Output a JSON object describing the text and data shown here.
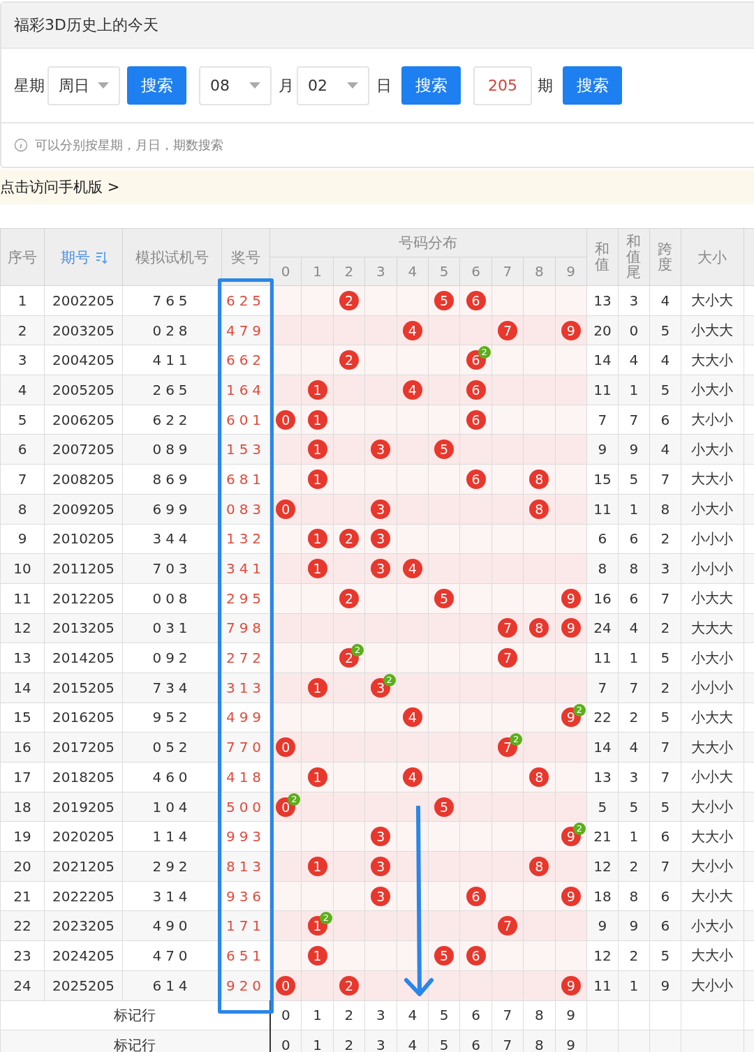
{
  "title": "福彩3D历史上的今天",
  "controls": [
    {
      "kind": "label",
      "text": "星期"
    },
    {
      "kind": "select",
      "value": "周日"
    },
    {
      "kind": "button",
      "text": "搜索"
    },
    {
      "kind": "select",
      "value": "08"
    },
    {
      "kind": "label",
      "text": "月"
    },
    {
      "kind": "select",
      "value": "02"
    },
    {
      "kind": "label",
      "text": "日"
    },
    {
      "kind": "button",
      "text": "搜索"
    },
    {
      "kind": "input",
      "value": "205"
    },
    {
      "kind": "label",
      "text": "期"
    },
    {
      "kind": "button",
      "text": "搜索"
    }
  ],
  "hint": "可以分别按星期，月日，期数搜索",
  "mobile_link": "点击访问手机版 >",
  "table": {
    "columns_left": [
      {
        "label": "序号",
        "sorted": false
      },
      {
        "label": "期号",
        "sorted": true
      },
      {
        "label": "模拟试机号",
        "sorted": false
      },
      {
        "label": "奖号",
        "sorted": false
      }
    ],
    "distribution_title": "号码分布",
    "digits": [
      "0",
      "1",
      "2",
      "3",
      "4",
      "5",
      "6",
      "7",
      "8",
      "9"
    ],
    "columns_right": [
      {
        "label": "和值",
        "sorted": false
      },
      {
        "label": "和值尾",
        "sorted": false
      },
      {
        "label": "跨度",
        "sorted": false
      },
      {
        "label": "大小",
        "sorted": false
      }
    ],
    "rows": [
      {
        "no": "1",
        "issue": "2002205",
        "trial": "765",
        "prize": "625",
        "distribution": [
          {
            "ball": false
          },
          {
            "ball": false
          },
          {
            "ball": true,
            "digit": "2"
          },
          {
            "ball": false
          },
          {
            "ball": false
          },
          {
            "ball": true,
            "digit": "5"
          },
          {
            "ball": true,
            "digit": "6"
          },
          {
            "ball": false
          },
          {
            "ball": false
          },
          {
            "ball": false
          }
        ],
        "sum": "13",
        "tail": "3",
        "span": "4",
        "size": "大小大"
      },
      {
        "no": "2",
        "issue": "2003205",
        "trial": "028",
        "prize": "479",
        "distribution": [
          {
            "ball": false
          },
          {
            "ball": false
          },
          {
            "ball": false
          },
          {
            "ball": false
          },
          {
            "ball": true,
            "digit": "4"
          },
          {
            "ball": false
          },
          {
            "ball": false
          },
          {
            "ball": true,
            "digit": "7"
          },
          {
            "ball": false
          },
          {
            "ball": true,
            "digit": "9"
          }
        ],
        "sum": "20",
        "tail": "0",
        "span": "5",
        "size": "小大大"
      },
      {
        "no": "3",
        "issue": "2004205",
        "trial": "411",
        "prize": "662",
        "distribution": [
          {
            "ball": false
          },
          {
            "ball": false
          },
          {
            "ball": true,
            "digit": "2"
          },
          {
            "ball": false
          },
          {
            "ball": false
          },
          {
            "ball": false
          },
          {
            "ball": true,
            "digit": "6",
            "repeat": "2"
          },
          {
            "ball": false
          },
          {
            "ball": false
          },
          {
            "ball": false
          }
        ],
        "sum": "14",
        "tail": "4",
        "span": "4",
        "size": "大大小"
      },
      {
        "no": "4",
        "issue": "2005205",
        "trial": "265",
        "prize": "164",
        "distribution": [
          {
            "ball": false
          },
          {
            "ball": true,
            "digit": "1"
          },
          {
            "ball": false
          },
          {
            "ball": false
          },
          {
            "ball": true,
            "digit": "4"
          },
          {
            "ball": false
          },
          {
            "ball": true,
            "digit": "6"
          },
          {
            "ball": false
          },
          {
            "ball": false
          },
          {
            "ball": false
          }
        ],
        "sum": "11",
        "tail": "1",
        "span": "5",
        "size": "小大小"
      },
      {
        "no": "5",
        "issue": "2006205",
        "trial": "622",
        "prize": "601",
        "distribution": [
          {
            "ball": true,
            "digit": "0"
          },
          {
            "ball": true,
            "digit": "1"
          },
          {
            "ball": false
          },
          {
            "ball": false
          },
          {
            "ball": false
          },
          {
            "ball": false
          },
          {
            "ball": true,
            "digit": "6"
          },
          {
            "ball": false
          },
          {
            "ball": false
          },
          {
            "ball": false
          }
        ],
        "sum": "7",
        "tail": "7",
        "span": "6",
        "size": "大小小"
      },
      {
        "no": "6",
        "issue": "2007205",
        "trial": "089",
        "prize": "153",
        "distribution": [
          {
            "ball": false
          },
          {
            "ball": true,
            "digit": "1"
          },
          {
            "ball": false
          },
          {
            "ball": true,
            "digit": "3"
          },
          {
            "ball": false
          },
          {
            "ball": true,
            "digit": "5"
          },
          {
            "ball": false
          },
          {
            "ball": false
          },
          {
            "ball": false
          },
          {
            "ball": false
          }
        ],
        "sum": "9",
        "tail": "9",
        "span": "4",
        "size": "小大小"
      },
      {
        "no": "7",
        "issue": "2008205",
        "trial": "869",
        "prize": "681",
        "distribution": [
          {
            "ball": false
          },
          {
            "ball": true,
            "digit": "1"
          },
          {
            "ball": false
          },
          {
            "ball": false
          },
          {
            "ball": false
          },
          {
            "ball": false
          },
          {
            "ball": true,
            "digit": "6"
          },
          {
            "ball": false
          },
          {
            "ball": true,
            "digit": "8"
          },
          {
            "ball": false
          }
        ],
        "sum": "15",
        "tail": "5",
        "span": "7",
        "size": "大大小"
      },
      {
        "no": "8",
        "issue": "2009205",
        "trial": "699",
        "prize": "083",
        "distribution": [
          {
            "ball": true,
            "digit": "0"
          },
          {
            "ball": false
          },
          {
            "ball": false
          },
          {
            "ball": true,
            "digit": "3"
          },
          {
            "ball": false
          },
          {
            "ball": false
          },
          {
            "ball": false
          },
          {
            "ball": false
          },
          {
            "ball": true,
            "digit": "8"
          },
          {
            "ball": false
          }
        ],
        "sum": "11",
        "tail": "1",
        "span": "8",
        "size": "小大小"
      },
      {
        "no": "9",
        "issue": "2010205",
        "trial": "344",
        "prize": "132",
        "distribution": [
          {
            "ball": false
          },
          {
            "ball": true,
            "digit": "1"
          },
          {
            "ball": true,
            "digit": "2"
          },
          {
            "ball": true,
            "digit": "3"
          },
          {
            "ball": false
          },
          {
            "ball": false
          },
          {
            "ball": false
          },
          {
            "ball": false
          },
          {
            "ball": false
          },
          {
            "ball": false
          }
        ],
        "sum": "6",
        "tail": "6",
        "span": "2",
        "size": "小小小"
      },
      {
        "no": "10",
        "issue": "2011205",
        "trial": "703",
        "prize": "341",
        "distribution": [
          {
            "ball": false
          },
          {
            "ball": true,
            "digit": "1"
          },
          {
            "ball": false
          },
          {
            "ball": true,
            "digit": "3"
          },
          {
            "ball": true,
            "digit": "4"
          },
          {
            "ball": false
          },
          {
            "ball": false
          },
          {
            "ball": false
          },
          {
            "ball": false
          },
          {
            "ball": false
          }
        ],
        "sum": "8",
        "tail": "8",
        "span": "3",
        "size": "小小小"
      },
      {
        "no": "11",
        "issue": "2012205",
        "trial": "008",
        "prize": "295",
        "distribution": [
          {
            "ball": false
          },
          {
            "ball": false
          },
          {
            "ball": true,
            "digit": "2"
          },
          {
            "ball": false
          },
          {
            "ball": false
          },
          {
            "ball": true,
            "digit": "5"
          },
          {
            "ball": false
          },
          {
            "ball": false
          },
          {
            "ball": false
          },
          {
            "ball": true,
            "digit": "9"
          }
        ],
        "sum": "16",
        "tail": "6",
        "span": "7",
        "size": "小大大"
      },
      {
        "no": "12",
        "issue": "2013205",
        "trial": "031",
        "prize": "798",
        "distribution": [
          {
            "ball": false
          },
          {
            "ball": false
          },
          {
            "ball": false
          },
          {
            "ball": false
          },
          {
            "ball": false
          },
          {
            "ball": false
          },
          {
            "ball": false
          },
          {
            "ball": true,
            "digit": "7"
          },
          {
            "ball": true,
            "digit": "8"
          },
          {
            "ball": true,
            "digit": "9"
          }
        ],
        "sum": "24",
        "tail": "4",
        "span": "2",
        "size": "大大大"
      },
      {
        "no": "13",
        "issue": "2014205",
        "trial": "092",
        "prize": "272",
        "distribution": [
          {
            "ball": false
          },
          {
            "ball": false
          },
          {
            "ball": true,
            "digit": "2",
            "repeat": "2"
          },
          {
            "ball": false
          },
          {
            "ball": false
          },
          {
            "ball": false
          },
          {
            "ball": false
          },
          {
            "ball": true,
            "digit": "7"
          },
          {
            "ball": false
          },
          {
            "ball": false
          }
        ],
        "sum": "11",
        "tail": "1",
        "span": "5",
        "size": "小大小"
      },
      {
        "no": "14",
        "issue": "2015205",
        "trial": "734",
        "prize": "313",
        "distribution": [
          {
            "ball": false
          },
          {
            "ball": true,
            "digit": "1"
          },
          {
            "ball": false
          },
          {
            "ball": true,
            "digit": "3",
            "repeat": "2"
          },
          {
            "ball": false
          },
          {
            "ball": false
          },
          {
            "ball": false
          },
          {
            "ball": false
          },
          {
            "ball": false
          },
          {
            "ball": false
          }
        ],
        "sum": "7",
        "tail": "7",
        "span": "2",
        "size": "小小小"
      },
      {
        "no": "15",
        "issue": "2016205",
        "trial": "952",
        "prize": "499",
        "distribution": [
          {
            "ball": false
          },
          {
            "ball": false
          },
          {
            "ball": false
          },
          {
            "ball": false
          },
          {
            "ball": true,
            "digit": "4"
          },
          {
            "ball": false
          },
          {
            "ball": false
          },
          {
            "ball": false
          },
          {
            "ball": false
          },
          {
            "ball": true,
            "digit": "9",
            "repeat": "2"
          }
        ],
        "sum": "22",
        "tail": "2",
        "span": "5",
        "size": "小大大"
      },
      {
        "no": "16",
        "issue": "2017205",
        "trial": "052",
        "prize": "770",
        "distribution": [
          {
            "ball": true,
            "digit": "0"
          },
          {
            "ball": false
          },
          {
            "ball": false
          },
          {
            "ball": false
          },
          {
            "ball": false
          },
          {
            "ball": false
          },
          {
            "ball": false
          },
          {
            "ball": true,
            "digit": "7",
            "repeat": "2"
          },
          {
            "ball": false
          },
          {
            "ball": false
          }
        ],
        "sum": "14",
        "tail": "4",
        "span": "7",
        "size": "大大小"
      },
      {
        "no": "17",
        "issue": "2018205",
        "trial": "460",
        "prize": "418",
        "distribution": [
          {
            "ball": false
          },
          {
            "ball": true,
            "digit": "1"
          },
          {
            "ball": false
          },
          {
            "ball": false
          },
          {
            "ball": true,
            "digit": "4"
          },
          {
            "ball": false
          },
          {
            "ball": false
          },
          {
            "ball": false
          },
          {
            "ball": true,
            "digit": "8"
          },
          {
            "ball": false
          }
        ],
        "sum": "13",
        "tail": "3",
        "span": "7",
        "size": "小小大"
      },
      {
        "no": "18",
        "issue": "2019205",
        "trial": "104",
        "prize": "500",
        "distribution": [
          {
            "ball": true,
            "digit": "0",
            "repeat": "2"
          },
          {
            "ball": false
          },
          {
            "ball": false
          },
          {
            "ball": false
          },
          {
            "ball": false
          },
          {
            "ball": true,
            "digit": "5"
          },
          {
            "ball": false
          },
          {
            "ball": false
          },
          {
            "ball": false
          },
          {
            "ball": false
          }
        ],
        "sum": "5",
        "tail": "5",
        "span": "5",
        "size": "大小小"
      },
      {
        "no": "19",
        "issue": "2020205",
        "trial": "114",
        "prize": "993",
        "distribution": [
          {
            "ball": false
          },
          {
            "ball": false
          },
          {
            "ball": false
          },
          {
            "ball": true,
            "digit": "3"
          },
          {
            "ball": false
          },
          {
            "ball": false
          },
          {
            "ball": false
          },
          {
            "ball": false
          },
          {
            "ball": false
          },
          {
            "ball": true,
            "digit": "9",
            "repeat": "2"
          }
        ],
        "sum": "21",
        "tail": "1",
        "span": "6",
        "size": "大大小"
      },
      {
        "no": "20",
        "issue": "2021205",
        "trial": "292",
        "prize": "813",
        "distribution": [
          {
            "ball": false
          },
          {
            "ball": true,
            "digit": "1"
          },
          {
            "ball": false
          },
          {
            "ball": true,
            "digit": "3"
          },
          {
            "ball": false
          },
          {
            "ball": false
          },
          {
            "ball": false
          },
          {
            "ball": false
          },
          {
            "ball": true,
            "digit": "8"
          },
          {
            "ball": false
          }
        ],
        "sum": "12",
        "tail": "2",
        "span": "7",
        "size": "大小小"
      },
      {
        "no": "21",
        "issue": "2022205",
        "trial": "314",
        "prize": "936",
        "distribution": [
          {
            "ball": false
          },
          {
            "ball": false
          },
          {
            "ball": false
          },
          {
            "ball": true,
            "digit": "3"
          },
          {
            "ball": false
          },
          {
            "ball": false
          },
          {
            "ball": true,
            "digit": "6"
          },
          {
            "ball": false
          },
          {
            "ball": false
          },
          {
            "ball": true,
            "digit": "9"
          }
        ],
        "sum": "18",
        "tail": "8",
        "span": "6",
        "size": "大小大"
      },
      {
        "no": "22",
        "issue": "2023205",
        "trial": "490",
        "prize": "171",
        "distribution": [
          {
            "ball": false
          },
          {
            "ball": true,
            "digit": "1",
            "repeat": "2"
          },
          {
            "ball": false
          },
          {
            "ball": false
          },
          {
            "ball": false
          },
          {
            "ball": false
          },
          {
            "ball": false
          },
          {
            "ball": true,
            "digit": "7"
          },
          {
            "ball": false
          },
          {
            "ball": false
          }
        ],
        "sum": "9",
        "tail": "9",
        "span": "6",
        "size": "小大小"
      },
      {
        "no": "23",
        "issue": "2024205",
        "trial": "470",
        "prize": "651",
        "distribution": [
          {
            "ball": false
          },
          {
            "ball": true,
            "digit": "1"
          },
          {
            "ball": false
          },
          {
            "ball": false
          },
          {
            "ball": false
          },
          {
            "ball": true,
            "digit": "5"
          },
          {
            "ball": true,
            "digit": "6"
          },
          {
            "ball": false
          },
          {
            "ball": false
          },
          {
            "ball": false
          }
        ],
        "sum": "12",
        "tail": "2",
        "span": "5",
        "size": "大大小"
      },
      {
        "no": "24",
        "issue": "2025205",
        "trial": "614",
        "prize": "920",
        "distribution": [
          {
            "ball": true,
            "digit": "0"
          },
          {
            "ball": false
          },
          {
            "ball": true,
            "digit": "2"
          },
          {
            "ball": false
          },
          {
            "ball": false
          },
          {
            "ball": false
          },
          {
            "ball": false
          },
          {
            "ball": false
          },
          {
            "ball": false
          },
          {
            "ball": true,
            "digit": "9"
          }
        ],
        "sum": "11",
        "tail": "1",
        "span": "9",
        "size": "大小小"
      }
    ],
    "footer_rows": [
      {
        "label": "标记行",
        "digits": [
          "0",
          "1",
          "2",
          "3",
          "4",
          "5",
          "6",
          "7",
          "8",
          "9"
        ]
      },
      {
        "label": "标记行",
        "digits": [
          "0",
          "1",
          "2",
          "3",
          "4",
          "5",
          "6",
          "7",
          "8",
          "9"
        ]
      }
    ]
  }
}
